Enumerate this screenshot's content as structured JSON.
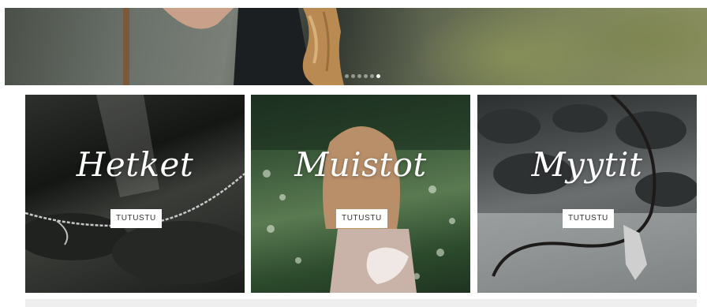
{
  "hero": {
    "slides_count": 6,
    "active_slide": 6
  },
  "cards": [
    {
      "title": "Hetket",
      "button_label": "TUTUSTU"
    },
    {
      "title": "Muistot",
      "button_label": "TUTUSTU"
    },
    {
      "title": "Myytit",
      "button_label": "TUTUSTU"
    }
  ]
}
